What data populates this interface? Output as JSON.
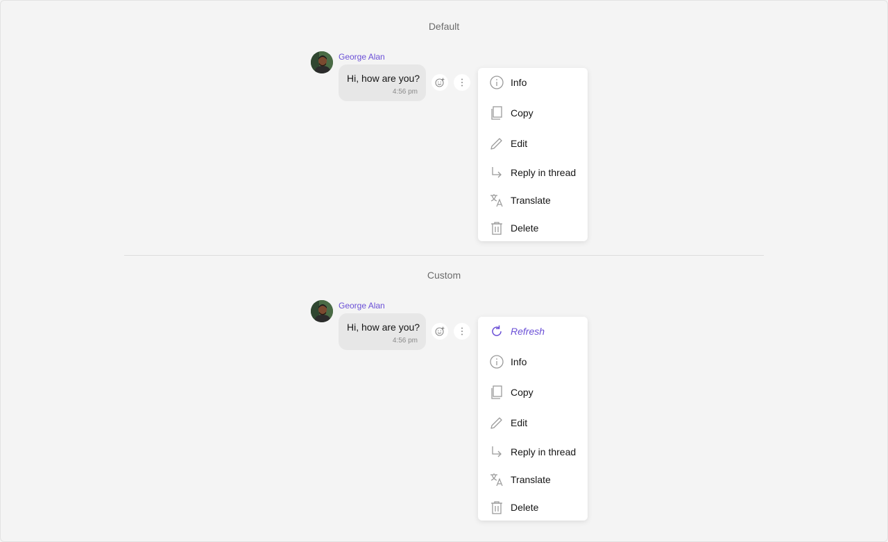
{
  "sections": [
    {
      "title": "Default",
      "message": {
        "sender": "George Alan",
        "text": "Hi, how are you?",
        "time": "4:56 pm"
      },
      "menu_items": [
        {
          "label": "Info",
          "icon": "info-icon"
        },
        {
          "label": "Copy",
          "icon": "copy-icon"
        },
        {
          "label": "Edit",
          "icon": "edit-icon"
        },
        {
          "label": "Reply in thread",
          "icon": "reply-icon"
        },
        {
          "label": "Translate",
          "icon": "translate-icon"
        },
        {
          "label": "Delete",
          "icon": "delete-icon"
        }
      ]
    },
    {
      "title": "Custom",
      "message": {
        "sender": "George Alan",
        "text": "Hi, how are you?",
        "time": "4:56 pm"
      },
      "menu_items": [
        {
          "label": "Refresh",
          "icon": "refresh-icon"
        },
        {
          "label": "Info",
          "icon": "info-icon"
        },
        {
          "label": "Copy",
          "icon": "copy-icon"
        },
        {
          "label": "Edit",
          "icon": "edit-icon"
        },
        {
          "label": "Reply in thread",
          "icon": "reply-icon"
        },
        {
          "label": "Translate",
          "icon": "translate-icon"
        },
        {
          "label": "Delete",
          "icon": "delete-icon"
        }
      ]
    }
  ],
  "colors": {
    "accent": "#6a4fd6",
    "bubble": "#e7e7e7",
    "background": "#f4f4f4",
    "icon": "#9a9a9a"
  }
}
